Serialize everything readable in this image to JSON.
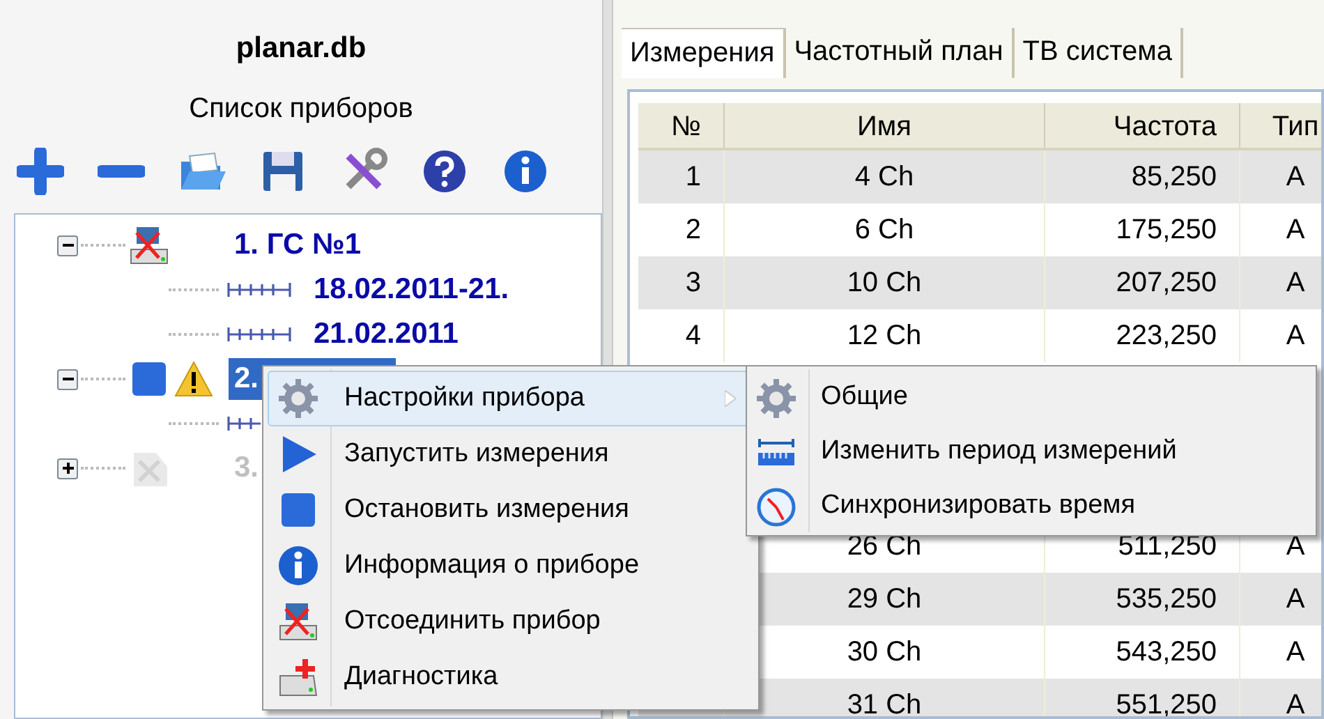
{
  "sidebar": {
    "title": "planar.db",
    "subtitle": "Список приборов",
    "tree": [
      {
        "label": "1. ГС №1",
        "kind": "disconnected",
        "expanded": true,
        "selected": false,
        "disabled": false,
        "warning": false,
        "children": [
          {
            "label": "18.02.2011-21.",
            "kind": "period"
          },
          {
            "label": "21.02.2011",
            "kind": "period"
          }
        ]
      },
      {
        "label": "2.",
        "kind": "stopped",
        "expanded": true,
        "selected": true,
        "disabled": false,
        "warning": true,
        "children": [
          {
            "kind": "period"
          }
        ]
      },
      {
        "label": "3.",
        "kind": "inactive",
        "expanded": false,
        "selected": false,
        "disabled": true,
        "warning": false
      }
    ]
  },
  "tabs": [
    {
      "label": "Измерения",
      "selected": true
    },
    {
      "label": "Частотный план",
      "selected": false
    },
    {
      "label": "ТВ система",
      "selected": false
    }
  ],
  "table": {
    "columns": [
      "№",
      "Имя",
      "Частота",
      "Тип"
    ],
    "rows": [
      {
        "number": "1",
        "name": "4 Ch",
        "frequency": "85,250",
        "type": "A"
      },
      {
        "number": "2",
        "name": "6 Ch",
        "frequency": "175,250",
        "type": "A"
      },
      {
        "number": "3",
        "name": "10 Ch",
        "frequency": "207,250",
        "type": "A"
      },
      {
        "number": "4",
        "name": "12 Ch",
        "frequency": "223,250",
        "type": "A"
      }
    ],
    "rows_below_menu": [
      {
        "name": "26 Ch",
        "frequency": "511,250",
        "type": "A"
      },
      {
        "name": "29 Ch",
        "frequency": "535,250",
        "type": "A"
      },
      {
        "name": "30 Ch",
        "frequency": "543,250",
        "type": "A"
      },
      {
        "name": "31 Ch",
        "frequency": "551,250",
        "type": "A"
      }
    ]
  },
  "context_menu": {
    "items": [
      {
        "label": "Настройки прибора",
        "kind": "gear",
        "selected": true,
        "submenu": true
      },
      {
        "label": "Запустить измерения",
        "kind": "play",
        "selected": false,
        "submenu": false
      },
      {
        "label": "Остановить измерения",
        "kind": "stop",
        "selected": false,
        "submenu": false
      },
      {
        "label": "Информация о приборе",
        "kind": "info",
        "selected": false,
        "submenu": false
      },
      {
        "label": "Отсоединить прибор",
        "kind": "disconnect",
        "selected": false,
        "submenu": false
      },
      {
        "label": "Диагностика",
        "kind": "diagnostics",
        "selected": false,
        "submenu": false
      }
    ],
    "submenu": [
      {
        "label": "Общие",
        "kind": "gear"
      },
      {
        "label": "Изменить период измерений",
        "kind": "ruler"
      },
      {
        "label": "Синхронизировать время",
        "kind": "clock"
      }
    ]
  }
}
